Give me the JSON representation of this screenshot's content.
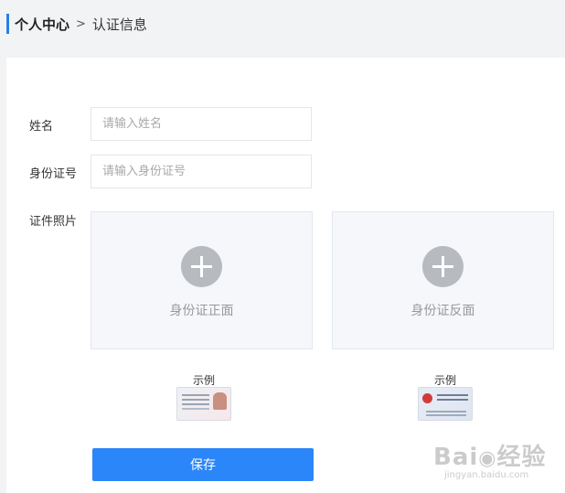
{
  "breadcrumb": {
    "root": "个人中心",
    "separator": ">",
    "current": "认证信息"
  },
  "form": {
    "name": {
      "label": "姓名",
      "placeholder": "请输入姓名",
      "value": ""
    },
    "id_number": {
      "label": "身份证号",
      "placeholder": "请输入身份证号",
      "value": ""
    },
    "photos": {
      "label": "证件照片",
      "front": {
        "upload_label": "身份证正面",
        "example_title": "示例"
      },
      "back": {
        "upload_label": "身份证反面",
        "example_title": "示例"
      }
    },
    "save_label": "保存"
  },
  "watermark": {
    "logo_text": "Bai",
    "logo_suffix": "经验",
    "url": "jingyan.baidu.com"
  },
  "colors": {
    "accent": "#2b86f9",
    "breadcrumb_bar": "#2b7de9",
    "upload_bg": "#f5f7fb",
    "plus_icon": "#b7babf"
  }
}
